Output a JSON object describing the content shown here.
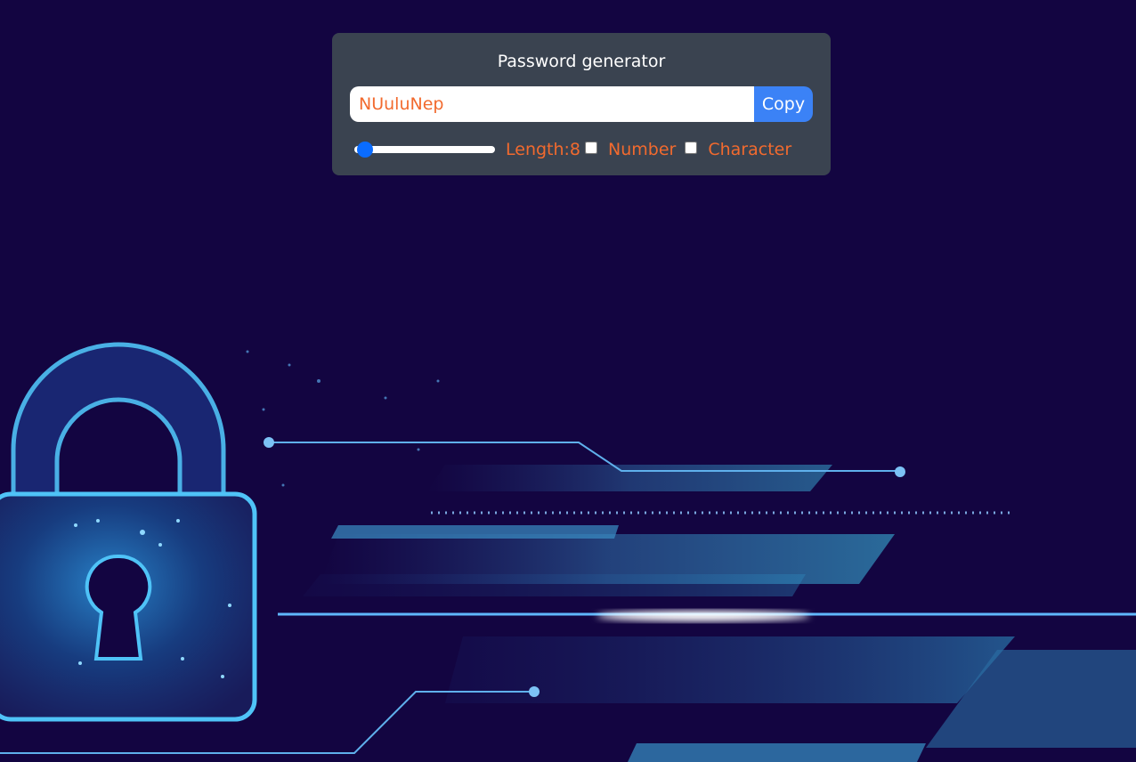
{
  "app": {
    "title": "Password generator"
  },
  "password": {
    "value": "NUuluNep"
  },
  "copy_button": {
    "label": "Copy"
  },
  "options": {
    "length_label": "Length:8",
    "length_value": 8,
    "number_label": "Number",
    "number_checked": false,
    "character_label": "Character",
    "character_checked": false
  },
  "colors": {
    "background": "#130541",
    "card": "#3a4350",
    "accent_text": "#f26a2e",
    "button": "#3b82f6",
    "glow": "#4fc3f7"
  },
  "background_art": {
    "icon": "padlock-icon"
  }
}
